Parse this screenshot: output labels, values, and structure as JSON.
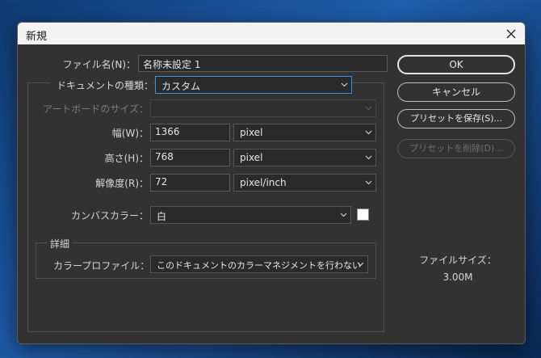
{
  "dialog": {
    "title": "新規",
    "close_icon": "close-icon"
  },
  "form": {
    "name_label": "ファイル名(N)：",
    "name_value": "名称未設定 1",
    "doc_type_label": "ドキュメントの種類：",
    "doc_type_value": "カスタム",
    "artboard_size_label": "アートボードのサイズ：",
    "artboard_size_value": "",
    "width_label": "幅(W)：",
    "width_value": "1366",
    "width_unit": "pixel",
    "height_label": "高さ(H)：",
    "height_value": "768",
    "height_unit": "pixel",
    "resolution_label": "解像度(R)：",
    "resolution_value": "72",
    "resolution_unit": "pixel/inch",
    "canvas_color_label": "カンバスカラー：",
    "canvas_color_value": "白",
    "canvas_color_swatch": "#ffffff",
    "advanced_label": "詳細",
    "color_profile_label": "カラープロファイル：",
    "color_profile_value": "このドキュメントのカラーマネジメントを行わない"
  },
  "buttons": {
    "ok": "OK",
    "cancel": "キャンセル",
    "save_preset": "プリセットを保存(S)...",
    "delete_preset": "プリセットを削除(D)..."
  },
  "info": {
    "file_size_label": "ファイルサイズ：",
    "file_size_value": "3.00M"
  },
  "colors": {
    "dialog_bg": "#323232",
    "focus_accent": "#3f8fe6"
  }
}
